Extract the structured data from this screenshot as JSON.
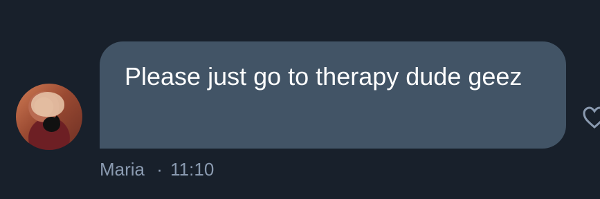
{
  "message": {
    "text": "Please just go to therapy dude geez",
    "sender": "Maria",
    "separator": "·",
    "time": "11:10"
  },
  "icons": {
    "avatar": "avatar",
    "reaction": "heart-icon"
  },
  "colors": {
    "background": "#18202b",
    "bubble": "#425466",
    "text": "#ffffff",
    "meta": "#8a9ab0",
    "icon": "#8a9ab0"
  }
}
